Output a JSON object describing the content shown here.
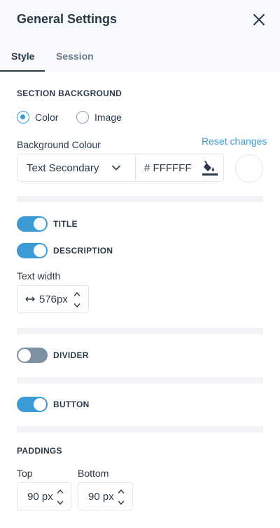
{
  "header": {
    "title": "General Settings",
    "close_icon": "close-icon",
    "tabs": [
      {
        "label": "Style",
        "active": true
      },
      {
        "label": "Session",
        "active": false
      }
    ]
  },
  "section_background": {
    "title": "SECTION BACKGROUND",
    "options": [
      {
        "label": "Color",
        "checked": true
      },
      {
        "label": "Image",
        "checked": false
      }
    ],
    "background_colour_label": "Background Colour",
    "reset_label": "Reset changes",
    "select_value": "Text Secondary",
    "hex_value": "# FFFFFF",
    "swatch_color": "#FFFFFF",
    "bucket_icon": "paint-bucket-icon"
  },
  "toggles": {
    "title": {
      "label": "TITLE",
      "on": true
    },
    "description": {
      "label": "DESCRIPTION",
      "on": true
    },
    "divider": {
      "label": "DIVIDER",
      "on": false
    },
    "button": {
      "label": "BUTTON",
      "on": true
    }
  },
  "text_width": {
    "label": "Text width",
    "value": "576px"
  },
  "paddings": {
    "title": "PADDINGS",
    "top_label": "Top",
    "top_value": "90 px",
    "bottom_label": "Bottom",
    "bottom_value": "90 px"
  },
  "colors": {
    "accent": "#3B9BD6",
    "text": "#2B3A48",
    "toggle_off": "#7E90A3"
  }
}
